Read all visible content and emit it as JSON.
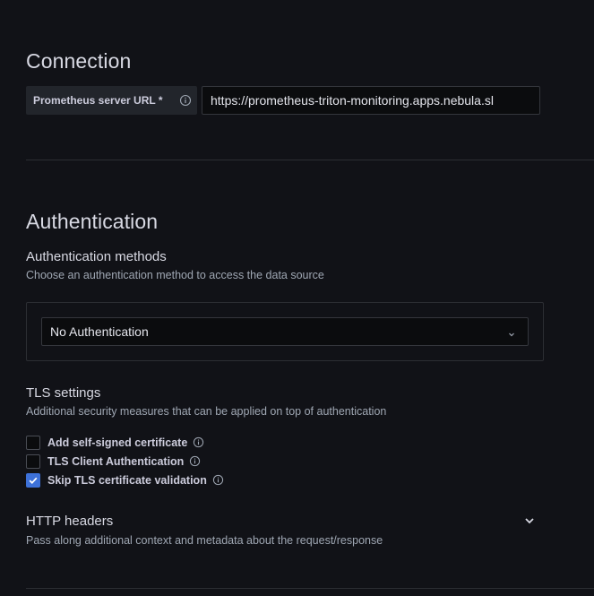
{
  "connection": {
    "title": "Connection",
    "url_label": "Prometheus server URL *",
    "url_value": "https://prometheus-triton-monitoring.apps.nebula.sl"
  },
  "authentication": {
    "title": "Authentication",
    "methods_title": "Authentication methods",
    "methods_desc": "Choose an authentication method to access the data source",
    "selected_method": "No Authentication"
  },
  "tls": {
    "title": "TLS settings",
    "desc": "Additional security measures that can be applied on top of authentication",
    "options": [
      {
        "label": "Add self-signed certificate",
        "checked": false
      },
      {
        "label": "TLS Client Authentication",
        "checked": false
      },
      {
        "label": "Skip TLS certificate validation",
        "checked": true
      }
    ]
  },
  "http_headers": {
    "title": "HTTP headers",
    "desc": "Pass along additional context and metadata about the request/response"
  },
  "icons": {
    "info": "info-circle-icon",
    "chevron": "chevron-down-icon",
    "check": "check-icon"
  },
  "colors": {
    "background": "#111217",
    "checkbox_checked": "#3d71d9"
  }
}
